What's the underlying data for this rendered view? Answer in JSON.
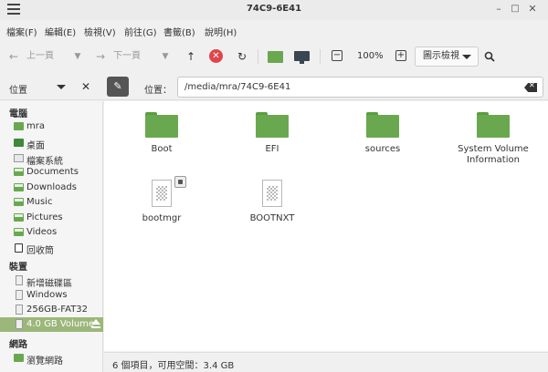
{
  "window": {
    "title": "74C9-6E41"
  },
  "menubar": [
    "檔案(F)",
    "編輯(E)",
    "檢視(V)",
    "前往(G)",
    "書籤(B)",
    "說明(H)"
  ],
  "toolbar": {
    "back": "上一頁",
    "forward": "下一頁",
    "zoom": "100%",
    "view_mode": "圖示檢視"
  },
  "sidebar_header": {
    "label": "位置"
  },
  "location": {
    "label": "位置：",
    "path": "/media/mra/74C9-6E41"
  },
  "sidebar": {
    "computer_title": "電腦",
    "computer": [
      "mra",
      "桌面",
      "檔案系統",
      "Documents",
      "Downloads",
      "Music",
      "Pictures",
      "Videos",
      "回收筒"
    ],
    "devices_title": "裝置",
    "devices": [
      "新增磁碟區",
      "Windows",
      "256GB-FAT32",
      "4.0 GB Volume"
    ],
    "network_title": "網路",
    "network": [
      "瀏覽網路"
    ]
  },
  "files": [
    {
      "name": "Boot",
      "type": "folder"
    },
    {
      "name": "EFI",
      "type": "folder"
    },
    {
      "name": "sources",
      "type": "folder"
    },
    {
      "name": "System Volume Information",
      "type": "folder"
    },
    {
      "name": "bootmgr",
      "type": "file",
      "locked": true
    },
    {
      "name": "BOOTNXT",
      "type": "file"
    }
  ],
  "status": "6 個項目，可用空間：3.4 GB"
}
